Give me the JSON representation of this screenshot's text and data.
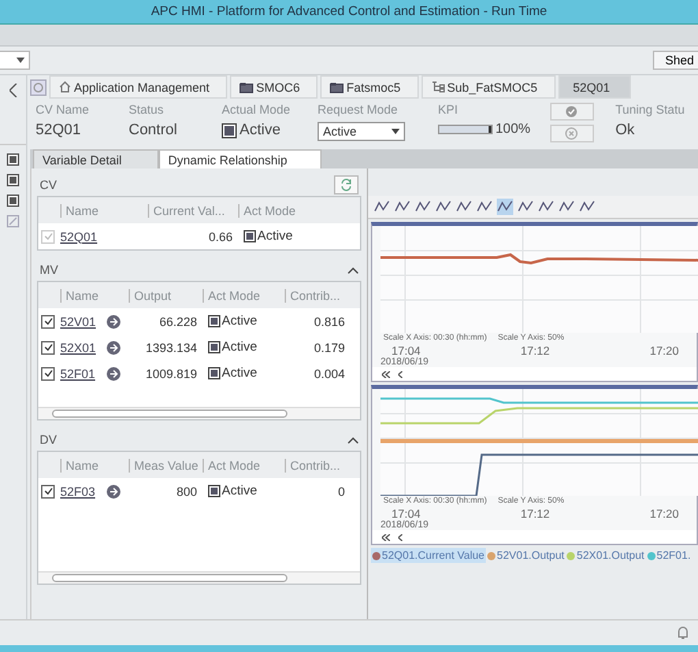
{
  "window": {
    "title": "APC HMI - Platform for Advanced Control and Estimation - Run Time"
  },
  "shed_button": {
    "label": "Shed"
  },
  "breadcrumb": [
    {
      "kind": "home",
      "label": "Application Management",
      "selected": false
    },
    {
      "kind": "folder",
      "label": "SMOC6",
      "selected": false
    },
    {
      "kind": "folder",
      "label": "Fatsmoc5",
      "selected": false
    },
    {
      "kind": "tree",
      "label": "Sub_FatSMOC5",
      "selected": false
    },
    {
      "kind": "plain",
      "label": "52Q01",
      "selected": true
    }
  ],
  "cv_header": {
    "cv_name": {
      "label": "CV Name",
      "value": "52Q01"
    },
    "status": {
      "label": "Status",
      "value": "Control"
    },
    "actual_mode": {
      "label": "Actual Mode",
      "value": "Active"
    },
    "request_mode": {
      "label": "Request Mode",
      "value": "Active"
    },
    "kpi": {
      "label": "KPI",
      "level": 1.0,
      "reading": "100%"
    },
    "tuning_status": {
      "label": "Tuning Statu",
      "value": "Ok"
    }
  },
  "tabs": [
    {
      "label": "Variable Detail",
      "selected": false
    },
    {
      "label": "Dynamic Relationship",
      "selected": true
    }
  ],
  "cv": {
    "title": "CV",
    "columns": [
      "Name",
      "Current Val...",
      "Act Mode"
    ],
    "rows": [
      {
        "name": "52Q01",
        "value": "0.66",
        "mode": "Active",
        "checked": true,
        "disabled": true
      }
    ]
  },
  "mv": {
    "title": "MV",
    "columns": [
      "Name",
      "Output",
      "Act Mode",
      "Contrib..."
    ],
    "rows": [
      {
        "name": "52V01",
        "value": "66.228",
        "mode": "Active",
        "contrib": "0.816",
        "checked": true,
        "disabled": false
      },
      {
        "name": "52X01",
        "value": "1393.134",
        "mode": "Active",
        "contrib": "0.179",
        "checked": true,
        "disabled": false
      },
      {
        "name": "52F01",
        "value": "1009.819",
        "mode": "Active",
        "contrib": "0.004",
        "checked": true,
        "disabled": false
      }
    ]
  },
  "dv": {
    "title": "DV",
    "columns": [
      "Name",
      "Meas Value",
      "Act Mode",
      "Contrib..."
    ],
    "rows": [
      {
        "name": "52F03",
        "value": "800",
        "mode": "Active",
        "contrib": "0",
        "checked": true,
        "disabled": false
      }
    ]
  },
  "charts": [
    {
      "scale_x": "Scale X Axis:  00:30 (hh:mm)",
      "scale_y": "Scale Y Axis:  50%",
      "times": [
        "17:04",
        "17:12",
        "17:20"
      ],
      "date": "2018/06/19"
    },
    {
      "scale_x": "Scale X Axis:  00:30 (hh:mm)",
      "scale_y": "Scale Y Axis:  50%",
      "times": [
        "17:04",
        "17:12",
        "17:20"
      ],
      "date": "2018/06/19"
    }
  ],
  "legend": [
    {
      "label": "52Q01.Current Value",
      "color": "#a86a6a",
      "selected": true
    },
    {
      "label": "52V01.Output",
      "color": "#d9a46e",
      "selected": false
    },
    {
      "label": "52X01.Output",
      "color": "#b9d46a",
      "selected": false
    },
    {
      "label": "52F01.",
      "color": "#52c4cc",
      "selected": false
    }
  ]
}
